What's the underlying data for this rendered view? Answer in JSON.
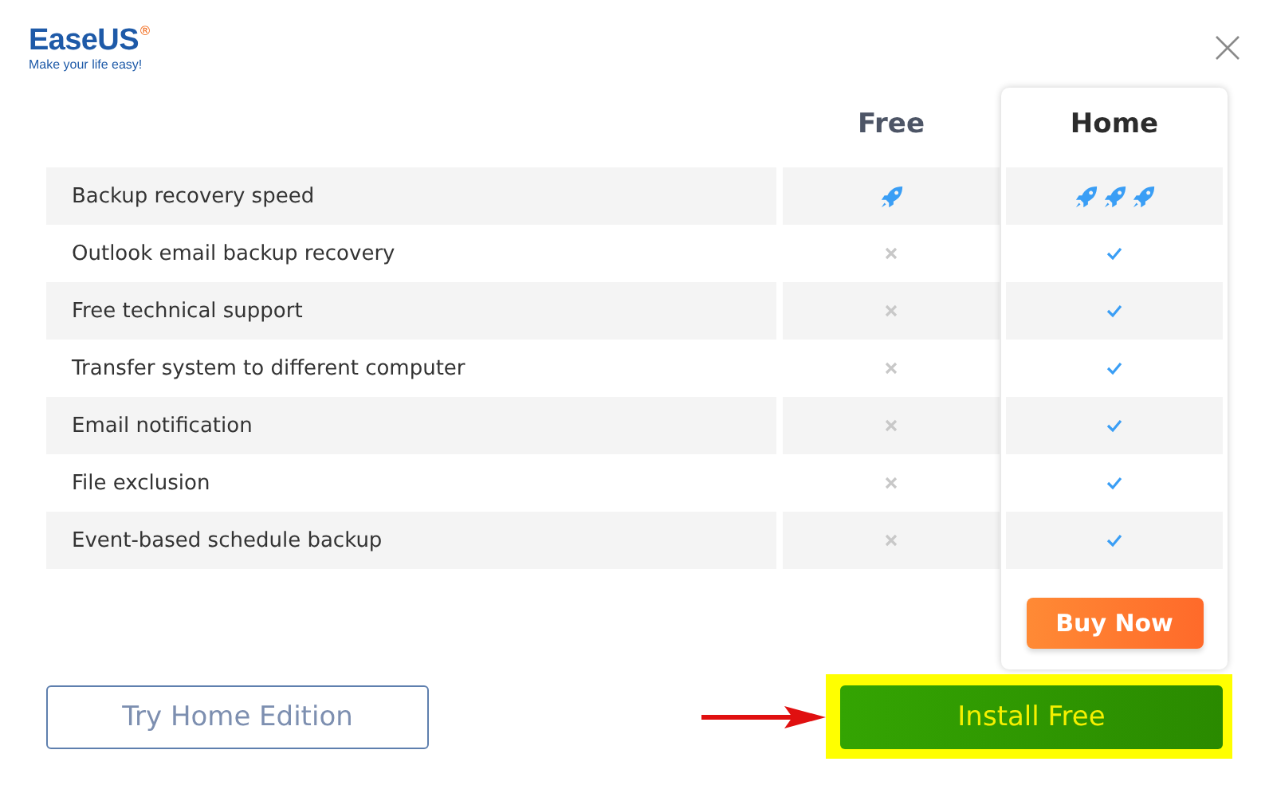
{
  "logo": {
    "name": "EaseUS",
    "registered": "®",
    "tagline": "Make your life easy!"
  },
  "columns": [
    {
      "label": "Free"
    },
    {
      "label": "Home"
    }
  ],
  "rows": [
    {
      "feature": "Backup recovery speed",
      "free": {
        "kind": "rocket"
      },
      "home": {
        "kind": "speed",
        "stars": 3
      }
    },
    {
      "feature": "Outlook email backup recovery",
      "free": {
        "kind": "cross"
      },
      "home": {
        "kind": "check"
      }
    },
    {
      "feature": "Free technical support",
      "free": {
        "kind": "cross"
      },
      "home": {
        "kind": "check"
      }
    },
    {
      "feature": "Transfer system to different computer",
      "free": {
        "kind": "cross"
      },
      "home": {
        "kind": "check"
      }
    },
    {
      "feature": "Email notification",
      "free": {
        "kind": "cross"
      },
      "home": {
        "kind": "check"
      }
    },
    {
      "feature": "File exclusion",
      "free": {
        "kind": "cross"
      },
      "home": {
        "kind": "check"
      }
    },
    {
      "feature": "Event-based schedule backup",
      "free": {
        "kind": "cross"
      },
      "home": {
        "kind": "check"
      }
    }
  ],
  "buy_button": "Buy Now",
  "try_button": "Try Home Edition",
  "install_button": "Install Free"
}
